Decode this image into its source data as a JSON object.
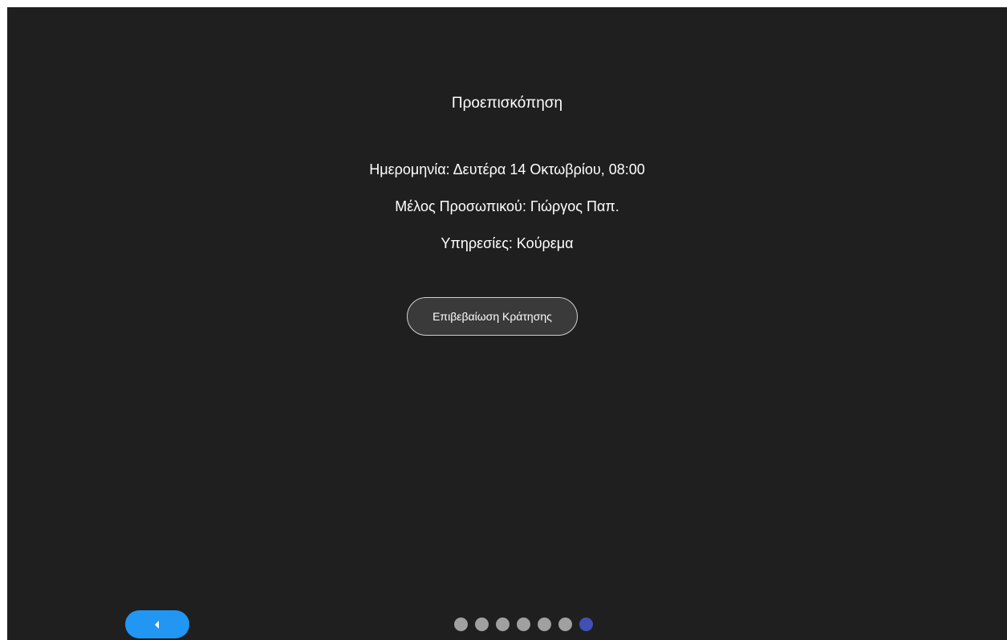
{
  "preview": {
    "title": "Προεπισκόπηση",
    "date_line": "Ημερομηνία: Δευτέρα 14 Οκτωβρίου, 08:00",
    "staff_line": "Μέλος Προσωπικού: Γιώργος Παπ.",
    "services_line": "Υπηρεσίες: Κούρεμα",
    "confirm_label": "Επιβεβαίωση Κράτησης"
  },
  "navigation": {
    "back_icon": "chevron-left-icon",
    "back_color": "#2196f3",
    "step_count": 7,
    "active_step": 7,
    "dot_color": "#a0a0a0",
    "active_dot_color": "#3f51b5"
  }
}
